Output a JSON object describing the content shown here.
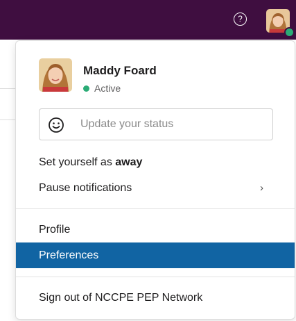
{
  "topbar": {
    "help_icon": "question-mark-icon",
    "help_glyph": "?",
    "avatar_status": "online"
  },
  "profile": {
    "name": "Maddy Foard",
    "status": "Active",
    "status_color": "#2bac76"
  },
  "status_input": {
    "icon": "smile-icon",
    "placeholder": "Update your status"
  },
  "menu": {
    "away_prefix": "Set yourself as ",
    "away_word": "away",
    "pause_notifications": "Pause notifications",
    "pause_chevron": "›",
    "profile": "Profile",
    "preferences": "Preferences",
    "sign_out": "Sign out of NCCPE PEP Network"
  },
  "colors": {
    "topbar": "#3f0e40",
    "highlight": "#1164a3",
    "presence": "#2bac76"
  }
}
